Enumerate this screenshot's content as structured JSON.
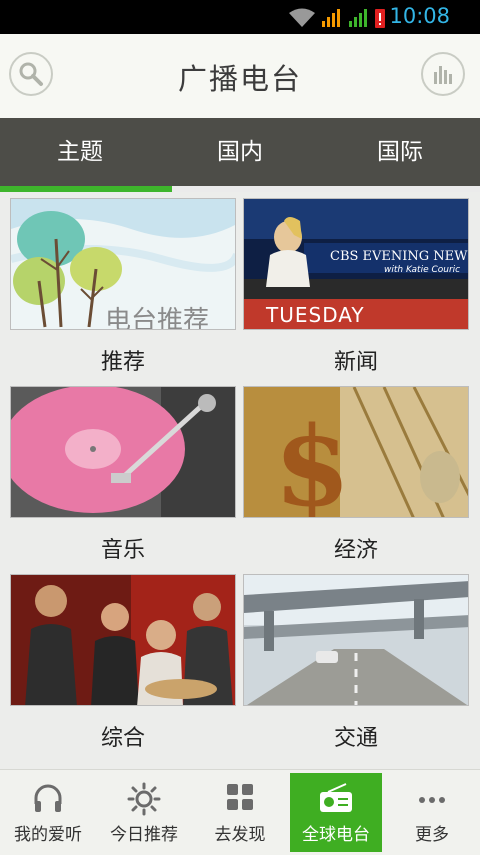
{
  "status_bar": {
    "time": "10:08"
  },
  "header": {
    "title": "广播电台"
  },
  "tabs": [
    {
      "label": "主题"
    },
    {
      "label": "国内"
    },
    {
      "label": "国际"
    }
  ],
  "thumbnails": {
    "recommend_caption": "电台推荐",
    "news_banner": "CBS EVENING NEWS",
    "news_sub": "with Katie Couric",
    "news_day": "TUESDAY"
  },
  "categories": [
    {
      "label": "推荐"
    },
    {
      "label": "新闻"
    },
    {
      "label": "音乐"
    },
    {
      "label": "经济"
    },
    {
      "label": "综合"
    },
    {
      "label": "交通"
    }
  ],
  "bottom_nav": [
    {
      "label": "我的爱听"
    },
    {
      "label": "今日推荐"
    },
    {
      "label": "去发现"
    },
    {
      "label": "全球电台"
    },
    {
      "label": "更多"
    }
  ],
  "colors": {
    "accent": "#3eb52c",
    "tab_bar": "#4d4d48",
    "status_text": "#33b5e5"
  }
}
